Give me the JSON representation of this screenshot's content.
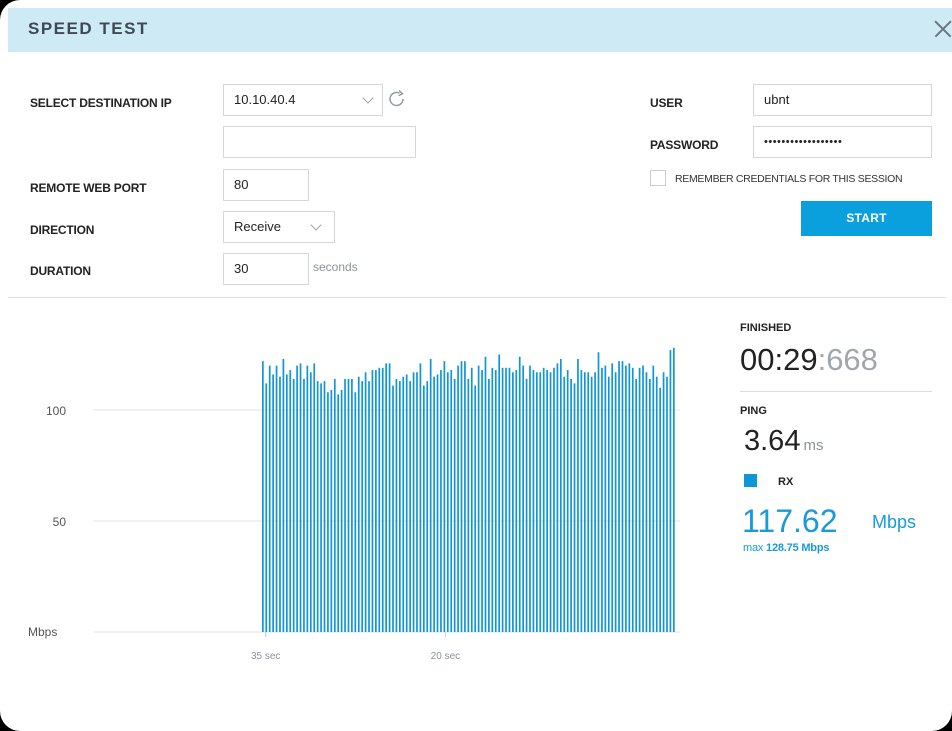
{
  "dialog": {
    "title": "SPEED TEST"
  },
  "form": {
    "destination_label": "SELECT DESTINATION IP",
    "destination_value": "10.10.40.4",
    "secondary_value": "",
    "remote_port_label": "REMOTE WEB PORT",
    "remote_port_value": "80",
    "direction_label": "DIRECTION",
    "direction_value": "Receive",
    "duration_label": "DURATION",
    "duration_value": "30",
    "duration_unit": "seconds"
  },
  "credentials": {
    "user_label": "USER",
    "user_value": "ubnt",
    "password_label": "PASSWORD",
    "password_value": "••••••••••••••••••",
    "remember_label": "REMEMBER CREDENTIALS FOR THIS SESSION",
    "remember_checked": false,
    "start_label": "START"
  },
  "stats": {
    "status_label": "FINISHED",
    "timer_main": "00:29",
    "timer_ms": ":668",
    "ping_label": "PING",
    "ping_value": "3.64",
    "ping_unit": "ms",
    "rx_label": "RX",
    "rx_value": "117.62",
    "rx_unit": "Mbps",
    "rx_max_prefix": "max",
    "rx_max_value": "128.75 Mbps"
  },
  "colors": {
    "header_bg": "#cdeaf5",
    "accent": "#0aa0de",
    "bar": "#1196d5"
  },
  "chart_data": {
    "type": "bar",
    "ylabel": "Mbps",
    "y_ticks": [
      {
        "value": 100,
        "label": "100"
      },
      {
        "value": 50,
        "label": "50"
      }
    ],
    "ylim": [
      0,
      150
    ],
    "x_ticks": [
      {
        "position": 35,
        "label": "35 sec"
      },
      {
        "position": 20,
        "label": "20 sec"
      }
    ],
    "x_range_sec_ago": [
      49,
      0
    ],
    "grid": true,
    "series": [
      {
        "name": "RX",
        "values": [
          122,
          112,
          120,
          116,
          120,
          115,
          123,
          116,
          118,
          114,
          120,
          121,
          114,
          120,
          117,
          121,
          113,
          112,
          113,
          108,
          109,
          114,
          107,
          109,
          114,
          114,
          114,
          108,
          115,
          113,
          117,
          113,
          118,
          118,
          119,
          119,
          121,
          121,
          111,
          114,
          113,
          115,
          116,
          113,
          117,
          117,
          121,
          111,
          113,
          123,
          115,
          116,
          118,
          122,
          117,
          118,
          114,
          120,
          122,
          122,
          114,
          119,
          111,
          120,
          118,
          124,
          114,
          119,
          118,
          125,
          119,
          119,
          119,
          117,
          118,
          124,
          120,
          114,
          120,
          118,
          117,
          117,
          119,
          118,
          117,
          119,
          121,
          123,
          115,
          118,
          114,
          112,
          123,
          118,
          117,
          117,
          115,
          117,
          126,
          119,
          120,
          115,
          121,
          117,
          122,
          122,
          120,
          121,
          119,
          114,
          119,
          120,
          117,
          114,
          120,
          115,
          110,
          117,
          115,
          127,
          128
        ]
      }
    ]
  }
}
